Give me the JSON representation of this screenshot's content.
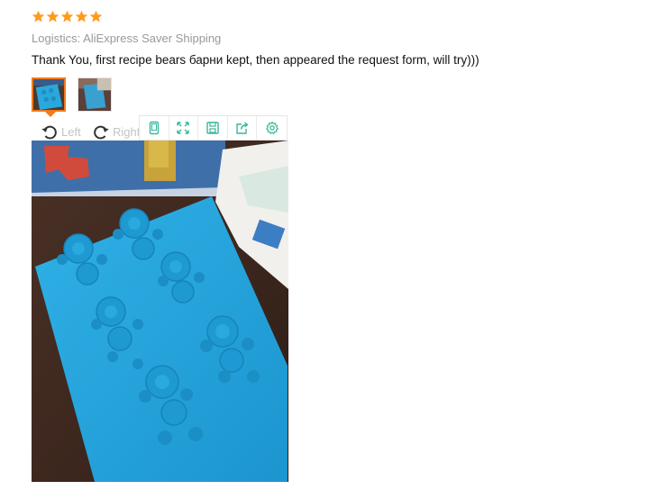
{
  "review": {
    "rating": 5,
    "rating_max": 5,
    "star_color": "#ff9a1a",
    "logistics": "Logistics: AliExpress Saver Shipping",
    "text": "Thank You, first recipe bears барни kept, then appeared the request form, will try)))"
  },
  "thumbnails": [
    {
      "icon": "bear-mold-photo-thumbnail",
      "selected": true
    },
    {
      "icon": "second-photo-thumbnail",
      "selected": false
    }
  ],
  "rotate": {
    "left_label": "Left",
    "right_label": "Right"
  },
  "toolbar": {
    "tools": [
      "mobile-view-icon",
      "fullscreen-icon",
      "save-icon",
      "share-icon",
      "settings-icon"
    ],
    "accent": "#38b89a"
  }
}
